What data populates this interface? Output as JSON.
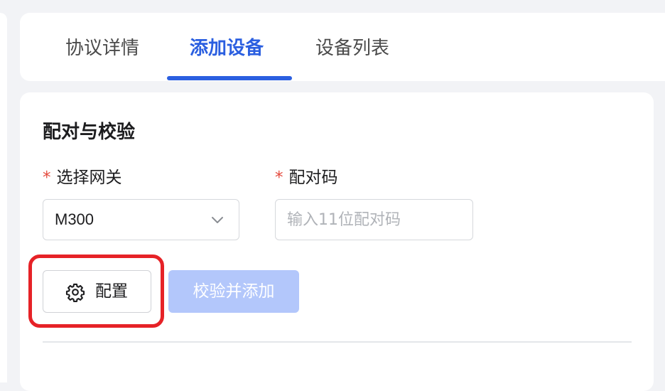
{
  "tabs": [
    {
      "label": "协议详情",
      "active": false
    },
    {
      "label": "添加设备",
      "active": true
    },
    {
      "label": "设备列表",
      "active": false
    }
  ],
  "section": {
    "title": "配对与校验"
  },
  "form": {
    "required_mark": "*",
    "gateway": {
      "label": "选择网关",
      "value": "M300",
      "icon": "chevron-down-icon"
    },
    "pair_code": {
      "label": "配对码",
      "value": "",
      "placeholder": "输入11位配对码"
    }
  },
  "buttons": {
    "config": {
      "label": "配置",
      "icon": "gear-icon"
    },
    "verify_add": {
      "label": "校验并添加",
      "disabled": true
    }
  },
  "colors": {
    "accent": "#2b5fe0",
    "required": "#e4493c",
    "highlight": "#e62227",
    "disabled_button": "#b3c7fb"
  }
}
